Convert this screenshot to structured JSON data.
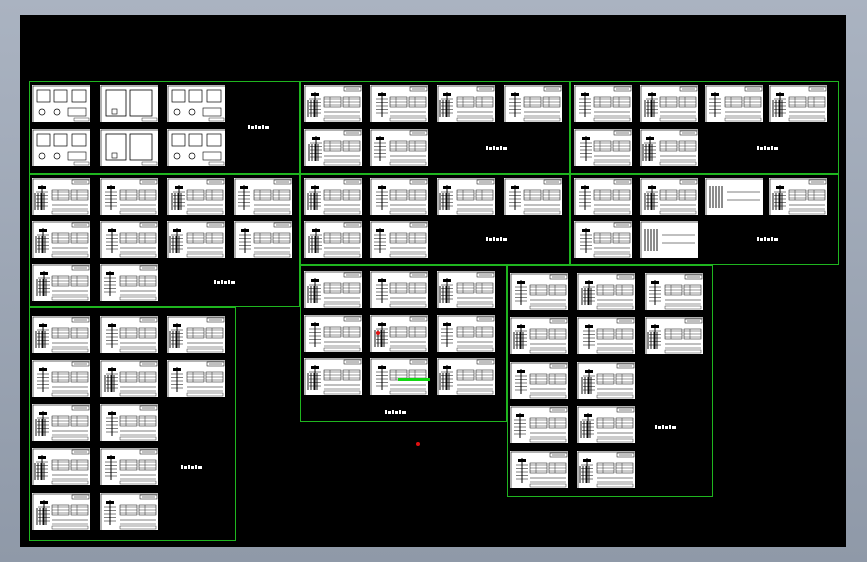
{
  "viewport": {
    "background_color": "#000000",
    "frame_color": "#1fb51f"
  },
  "groups": [
    {
      "label": "",
      "sheet_rows": [
        [
          "plan",
          "plan",
          "plan",
          null
        ],
        [
          "plan",
          "plan",
          "plan",
          null
        ],
        [
          "col",
          "col",
          "col",
          "col"
        ],
        [
          "col",
          "col",
          "col",
          "col"
        ],
        [
          "col",
          "col",
          null,
          null
        ],
        [
          "col",
          "col",
          "col",
          null
        ],
        [
          "col",
          "col",
          "col",
          null
        ],
        [
          "col",
          "col",
          null,
          null
        ],
        [
          "col",
          "col",
          null,
          null
        ],
        [
          "col",
          "col",
          null,
          null
        ]
      ]
    },
    {
      "label": "",
      "sheet_rows": [
        [
          "col",
          "col",
          "col",
          "col"
        ],
        [
          "col",
          "col",
          null,
          null
        ],
        [
          "col",
          "col",
          "col",
          "col"
        ],
        [
          "col",
          "col",
          null,
          null
        ],
        [
          "col",
          "col",
          "col",
          null
        ],
        [
          "col",
          "col",
          "col",
          null
        ],
        [
          "col",
          "col",
          "col",
          null
        ]
      ]
    },
    {
      "label": "",
      "sheet_rows": [
        [
          "col",
          "col",
          "col",
          "col"
        ],
        [
          "col",
          "col",
          null,
          null
        ],
        [
          "col",
          "col",
          "blank",
          "col"
        ],
        [
          "col",
          "blank",
          null,
          null
        ]
      ]
    },
    {
      "label": "",
      "sheet_rows": [
        [
          "col",
          "col",
          "col"
        ],
        [
          "col",
          "col",
          "col"
        ],
        [
          "col",
          "col",
          null
        ],
        [
          "col",
          "col",
          null
        ],
        [
          "col",
          "col",
          null
        ]
      ]
    }
  ],
  "highlight_color": "#12d812",
  "marker_color": "#e01010"
}
